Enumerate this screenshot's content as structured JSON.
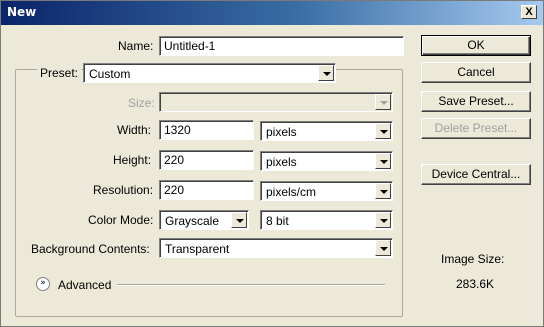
{
  "window": {
    "title": "New",
    "close_label": "X"
  },
  "form": {
    "name_label": "Name:",
    "name_value": "Untitled-1",
    "preset_label": "Preset:",
    "preset_value": "Custom",
    "size_label": "Size:",
    "size_value": "",
    "width_label": "Width:",
    "width_value": "1320",
    "width_unit": "pixels",
    "height_label": "Height:",
    "height_value": "220",
    "height_unit": "pixels",
    "resolution_label": "Resolution:",
    "resolution_value": "220",
    "resolution_unit": "pixels/cm",
    "colormode_label": "Color Mode:",
    "colormode_value": "Grayscale",
    "bitdepth_value": "8 bit",
    "background_label": "Background Contents:",
    "background_value": "Transparent",
    "advanced_label": "Advanced"
  },
  "buttons": {
    "ok": "OK",
    "cancel": "Cancel",
    "save_preset": "Save Preset...",
    "delete_preset": "Delete Preset...",
    "device_central": "Device Central..."
  },
  "image_size": {
    "label": "Image Size:",
    "value": "283.6K"
  }
}
